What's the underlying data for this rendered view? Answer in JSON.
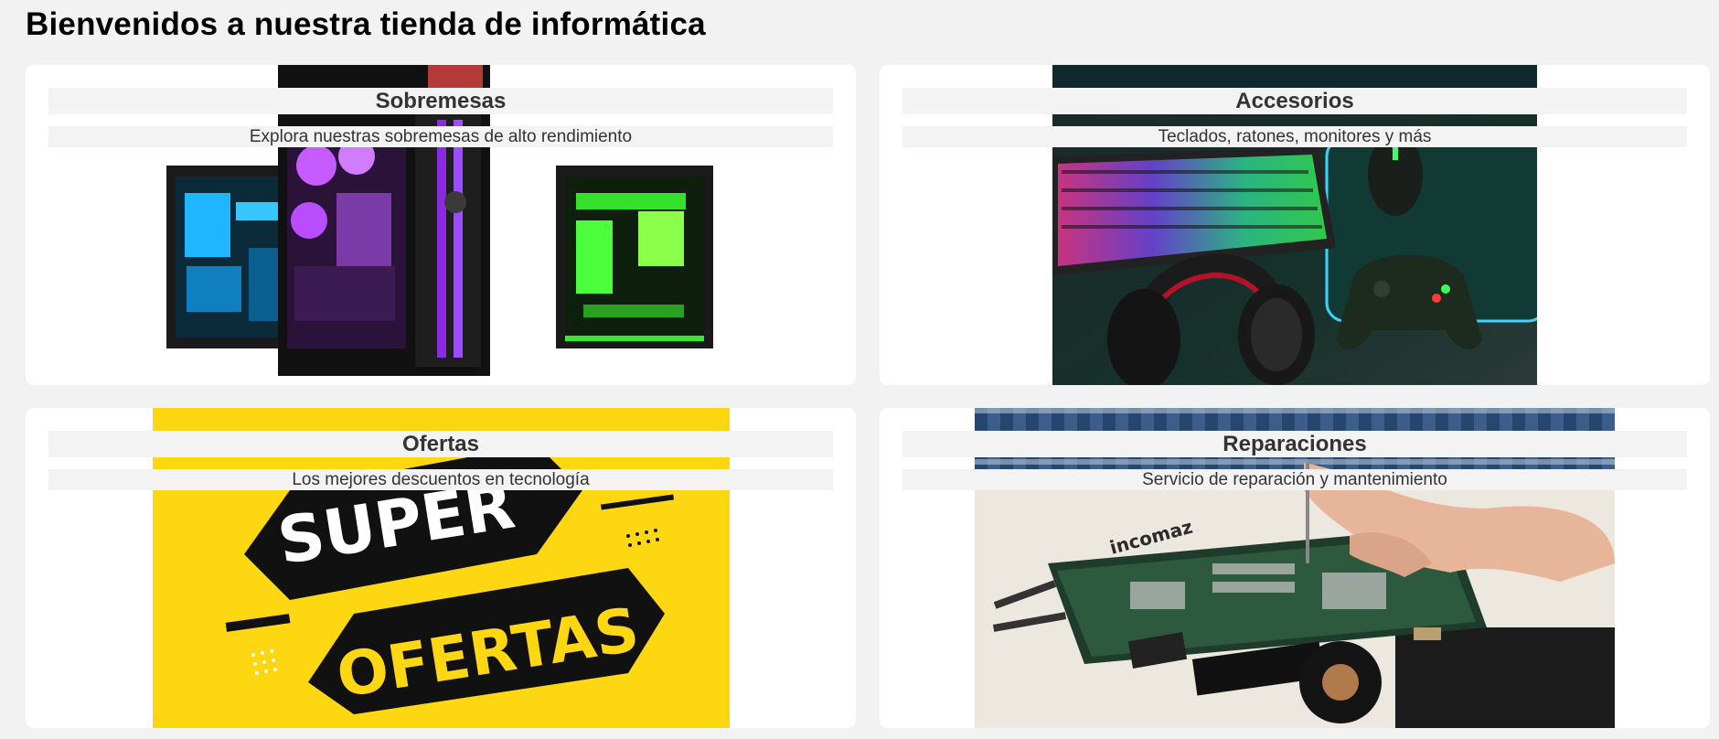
{
  "page": {
    "title": "Bienvenidos a nuestra tienda de informática"
  },
  "cards": [
    {
      "title": "Sobremesas",
      "description": "Explora nuestras sobremesas de alto rendimiento",
      "image_icon": "desktop-pc-image"
    },
    {
      "title": "Accesorios",
      "description": "Teclados, ratones, monitores y más",
      "image_icon": "gaming-accessories-image"
    },
    {
      "title": "Ofertas",
      "description": "Los mejores descuentos en tecnología",
      "image_icon": "super-ofertas-image",
      "image_text": [
        "SUPER",
        "OFERTAS"
      ]
    },
    {
      "title": "Reparaciones",
      "description": "Servicio de reparación y mantenimiento",
      "image_icon": "repair-motherboard-image",
      "image_text": [
        "incomaz"
      ]
    }
  ],
  "colors": {
    "page_background": "#f2f2f2",
    "card_background": "#ffffff",
    "label_background": "#f3f3f3",
    "ofertas_yellow": "#fdd712"
  }
}
